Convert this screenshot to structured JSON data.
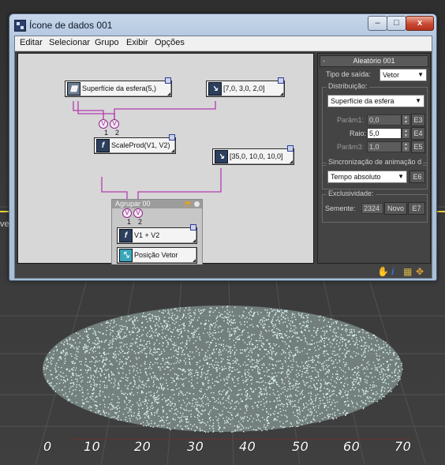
{
  "window": {
    "title": "Ícone de dados 001",
    "controls": {
      "minimize": "–",
      "maximize": "□",
      "close": "x"
    }
  },
  "menubar": {
    "items": [
      "Editar",
      "Selecionar",
      "Grupo",
      "Exibir",
      "Opções"
    ]
  },
  "graph": {
    "nodes": {
      "surface": "Superfície da esfera(5,)",
      "vector1": "[7,0, 3,0, 2,0]",
      "scaleprod": "ScaleProd(V1, V2)",
      "vector2": "[35,0, 10,0, 10,0]",
      "add": "V1 + V2",
      "position": "Posição Vetor"
    },
    "ports": {
      "v": "V",
      "one": "1",
      "two": "2"
    },
    "group": {
      "title": "Agrupar 00"
    },
    "icons": {
      "surface": "sphere-surface-icon",
      "vector": "vector-icon",
      "function": "function-icon",
      "position": "position-output-icon"
    },
    "colors": {
      "wire": "#b43cb1",
      "port_outline": "#2f3d9a"
    }
  },
  "panel": {
    "rollout_title": "Aleatório 001",
    "collapse": "-",
    "output_type_label": "Tipo de saída:",
    "output_type_value": "Vetor",
    "distribution_label": "Distribuição:",
    "distribution_value": "Superfície da esfera",
    "params": [
      {
        "label": "Parâm1:",
        "value": "0,0",
        "ebutton": "E3"
      },
      {
        "label": "Raio:",
        "value": "5,0",
        "ebutton": "E4"
      },
      {
        "label": "Parâm3:",
        "value": "1,0",
        "ebutton": "E5"
      }
    ],
    "sync_group": "Sincronização de animação d",
    "sync_value": "Tempo absoluto",
    "sync_ebutton": "E6",
    "exclusivity_group": "Exclusividade:",
    "seed_label": "Semente:",
    "seed_value": "2324",
    "new_button": "Novo",
    "seed_ebutton": "E7"
  },
  "statusbar": {
    "icons": [
      "hand-icon",
      "info-icon",
      "grid-icon",
      "move-icon"
    ]
  },
  "viewport": {
    "side_letter": "ve",
    "ruler": [
      "0",
      "10",
      "20",
      "30",
      "40",
      "50",
      "60",
      "70"
    ],
    "particle_color": "#dff6f3"
  }
}
